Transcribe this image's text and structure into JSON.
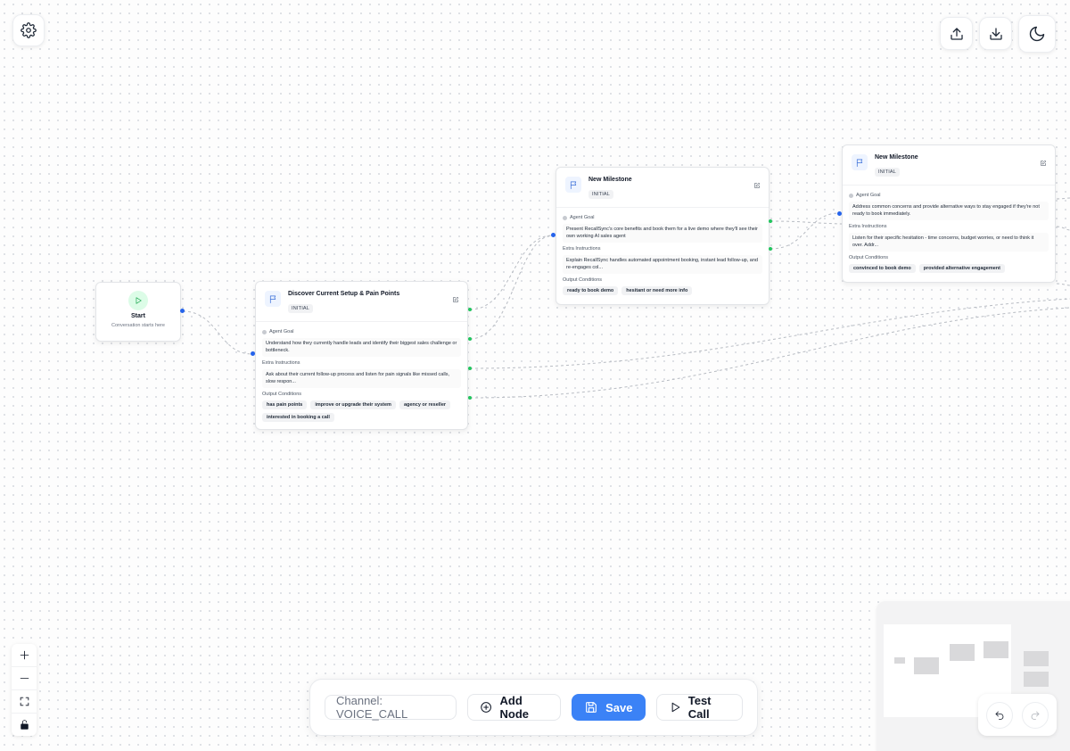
{
  "toolbar": {
    "settings_icon": "gear-icon",
    "upload_icon": "upload-icon",
    "download_icon": "download-icon",
    "theme_icon": "moon-icon"
  },
  "start": {
    "title": "Start",
    "subtitle": "Conversation starts here"
  },
  "nodes": [
    {
      "title": "Discover Current Setup & Pain Points",
      "badge": "INITIAL",
      "goal_label": "Agent Goal",
      "goal": "Understand how they currently handle leads and identify their biggest sales challenge or bottleneck.",
      "instructions_label": "Extra Instructions",
      "instructions": "Ask about their current follow-up process and listen for pain signals like missed calls, slow respon...",
      "conditions_label": "Output Conditions",
      "conditions": [
        "has pain points",
        "improve or upgrade their system",
        "agency or reseller",
        "interested in booking a call"
      ]
    },
    {
      "title": "New Milestone",
      "badge": "INITIAL",
      "goal_label": "Agent Goal",
      "goal": "Present RecallSync's core benefits and book them for a live demo where they'll see their own working AI sales agent",
      "instructions_label": "Extra Instructions",
      "instructions": "Explain RecallSync handles automated appointment booking, instant lead follow-up, and re-engages col...",
      "conditions_label": "Output Conditions",
      "conditions": [
        "ready to book demo",
        "hesitant or need more info"
      ]
    },
    {
      "title": "New Milestone",
      "badge": "INITIAL",
      "goal_label": "Agent Goal",
      "goal": "Address common concerns and provide alternative ways to stay engaged if they're not ready to book immediately.",
      "instructions_label": "Extra Instructions",
      "instructions": "Listen for their specific hesitation - time concerns, budget worries, or need to think it over. Addr...",
      "conditions_label": "Output Conditions",
      "conditions": [
        "convinced to book demo",
        "provided alternative engagement"
      ]
    }
  ],
  "bottom_bar": {
    "channel": "Channel: VOICE_CALL",
    "add_node": "Add Node",
    "save": "Save",
    "test_call": "Test Call"
  },
  "colors": {
    "accent": "#3b82f6",
    "handle_in": "#2563eb",
    "handle_out": "#22c55e"
  }
}
